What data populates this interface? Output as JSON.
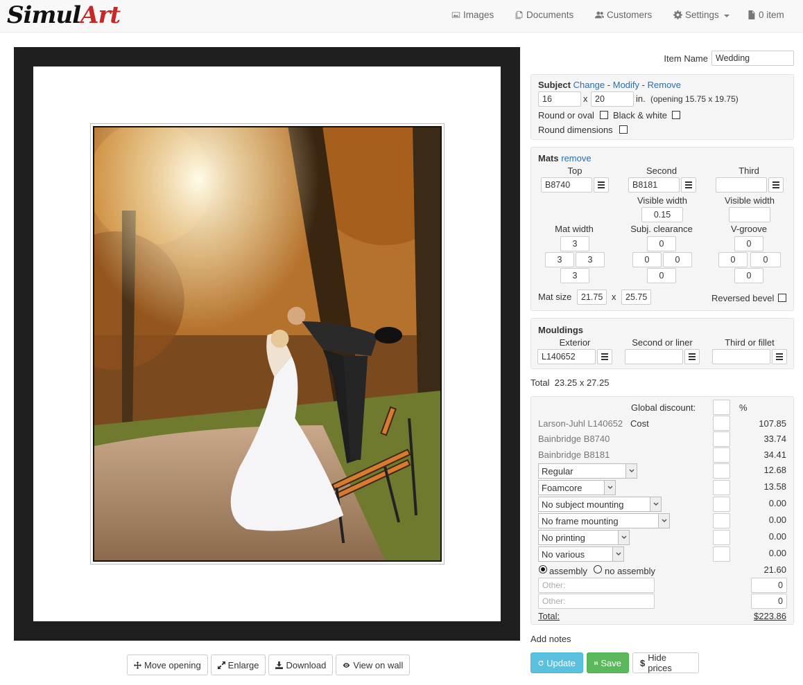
{
  "brand": {
    "part1": "Simul",
    "part2": "Art"
  },
  "nav": {
    "images": "Images",
    "documents": "Documents",
    "customers": "Customers",
    "settings": "Settings",
    "items": "0 item"
  },
  "preview_buttons": {
    "move_opening": "Move opening",
    "enlarge": "Enlarge",
    "download": "Download",
    "view_on_wall": "View on wall"
  },
  "item_name": {
    "label": "Item Name",
    "value": "Wedding"
  },
  "subject": {
    "title": "Subject",
    "change": "Change",
    "modify": "Modify",
    "remove": "Remove",
    "sep": "-",
    "width": "16",
    "x": "x",
    "height": "20",
    "unit": "in.",
    "opening": "(opening 15.75 x 19.75)",
    "round_or_oval": "Round or oval",
    "black_white": "Black & white",
    "round_dimensions": "Round dimensions"
  },
  "mats": {
    "title": "Mats",
    "remove": "remove",
    "top": "Top",
    "second": "Second",
    "third": "Third",
    "top_code": "B8740",
    "second_code": "B8181",
    "third_code": "",
    "visible_width": "Visible width",
    "visible_width_second": "0.15",
    "visible_width_third": "",
    "mat_width": "Mat width",
    "subj_clearance": "Subj. clearance",
    "v_groove": "V-groove",
    "mw_top": "3",
    "mw_left": "3",
    "mw_right": "3",
    "mw_bottom": "3",
    "sc_top": "0",
    "sc_left": "0",
    "sc_right": "0",
    "sc_bottom": "0",
    "vg_top": "0",
    "vg_left": "0",
    "vg_right": "0",
    "vg_bottom": "0",
    "mat_size": "Mat size",
    "mat_size_w": "21.75",
    "x": "x",
    "mat_size_h": "25.75",
    "reversed_bevel": "Reversed bevel"
  },
  "mouldings": {
    "title": "Mouldings",
    "exterior": "Exterior",
    "second_liner": "Second or liner",
    "third_fillet": "Third or fillet",
    "exterior_code": "L140652"
  },
  "total_size": "Total  23.25 x 27.25",
  "pricing": {
    "global_discount": "Global discount:",
    "percent": "%",
    "rows": [
      {
        "label": "Larson-Juhl L140652",
        "link": "Cost",
        "value": "107.85"
      },
      {
        "label": "Bainbridge B8740",
        "value": "33.74"
      },
      {
        "label": "Bainbridge B8181",
        "value": "34.41"
      }
    ],
    "selects": [
      {
        "value": "Regular",
        "price": "12.68"
      },
      {
        "value": "Foamcore",
        "price": "13.58"
      },
      {
        "value": "No subject mounting",
        "price": "0.00"
      },
      {
        "value": "No frame mounting",
        "price": "0.00"
      },
      {
        "value": "No printing",
        "price": "0.00"
      },
      {
        "value": "No various",
        "price": "0.00"
      }
    ],
    "assembly": "assembly",
    "no_assembly": "no assembly",
    "assembly_price": "21.60",
    "other_placeholder": "Other:",
    "other1_value": "0",
    "other2_value": "0",
    "total_label": "Total:",
    "total_value": "$223.86"
  },
  "add_notes": "Add notes",
  "actions": {
    "update": "Update",
    "save": "Save",
    "hide_prices": "Hide prices"
  },
  "colors": {
    "link": "#2a6fb0",
    "update_btn": "#5bc0de",
    "save_btn": "#5cb85c",
    "brand_red": "#c62828"
  }
}
